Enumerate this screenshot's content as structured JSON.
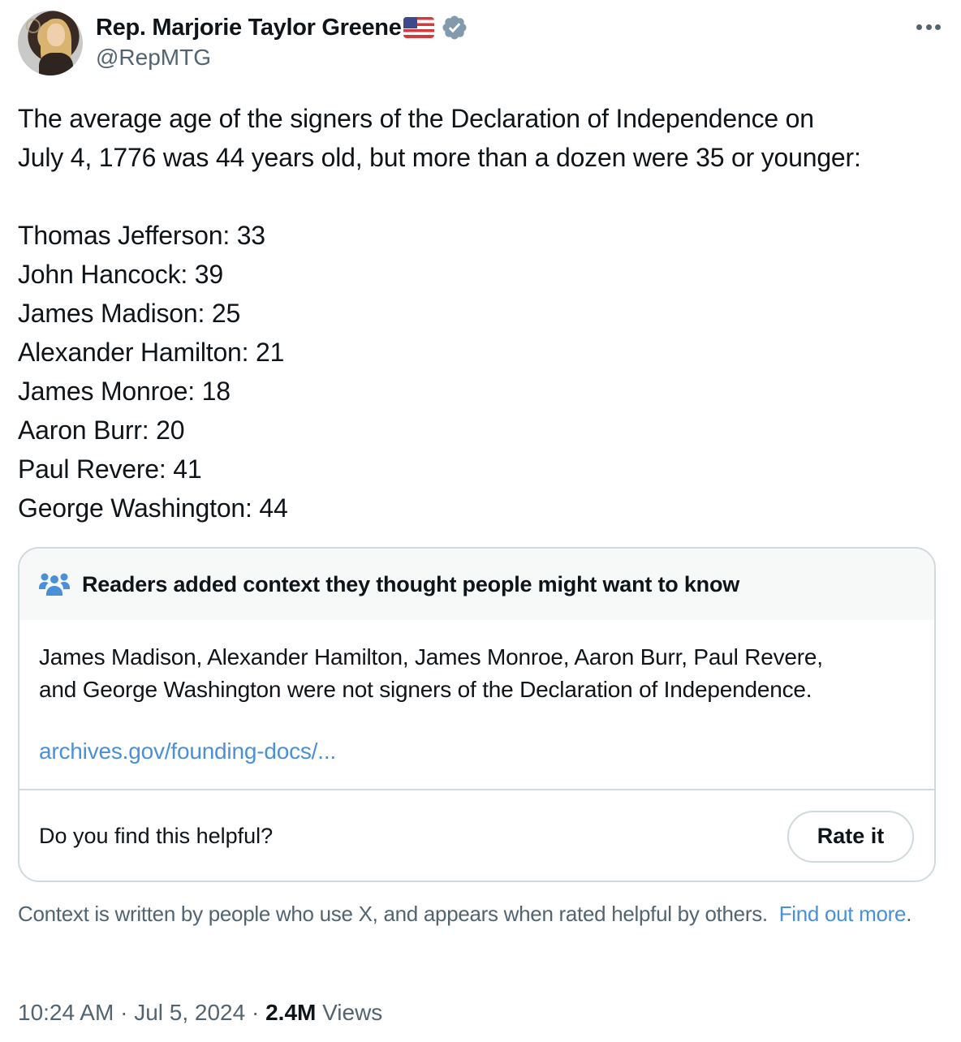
{
  "author": {
    "display_name": "Rep. Marjorie Taylor Greene",
    "handle": "@RepMTG",
    "flag_emoji": "us-flag",
    "verified": true,
    "verified_color": "#829aab"
  },
  "more_menu_icon": "more-horizontal-icon",
  "tweet": {
    "intro_line_1": "The average age of the signers of the Declaration of Independence on",
    "intro_line_2": "July 4, 1776 was 44 years old, but more than a dozen were 35 or younger:",
    "list": [
      "Thomas Jefferson: 33",
      "John Hancock: 39",
      "James Madison: 25",
      "Alexander Hamilton: 21",
      "James Monroe: 18",
      "Aaron Burr: 20",
      "Paul Revere: 41",
      "George Washington: 44"
    ]
  },
  "community_note": {
    "icon": "people-group-icon",
    "icon_color": "#4a90d9",
    "title": "Readers added context they thought people might want to know",
    "text_line_1": "James Madison, Alexander Hamilton, James Monroe, Aaron Burr, Paul Revere,",
    "text_line_2": "and George Washington were not signers of the Declaration of Independence.",
    "link": "archives.gov/founding-docs/...",
    "helpful_prompt": "Do you find this helpful?",
    "rate_button": "Rate it"
  },
  "disclaimer": {
    "text": "Context is written by people who use X, and appears when rated helpful by others.",
    "link": "Find out more",
    "suffix": "."
  },
  "meta": {
    "time": "10:24 AM",
    "separator": "·",
    "date": "Jul 5, 2024",
    "views_count": "2.4M",
    "views_label": "Views"
  }
}
